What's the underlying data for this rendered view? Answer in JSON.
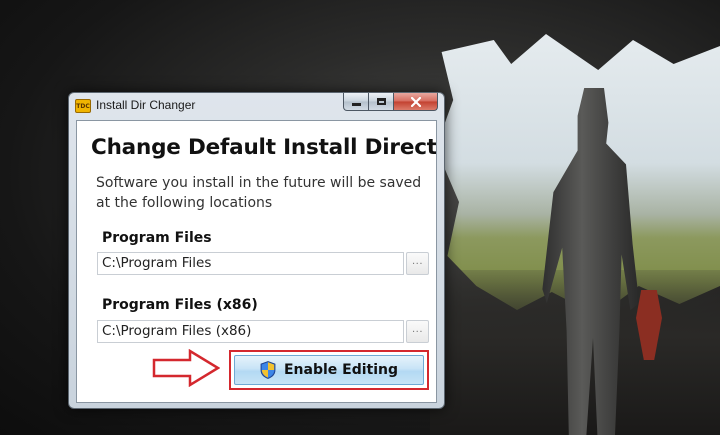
{
  "window": {
    "title": "Install Dir Changer",
    "app_icon_text": "TDC"
  },
  "content": {
    "heading": "Change Default Install Directo",
    "description": "Software you install in the future will be saved at the following locations",
    "program_files": {
      "label": "Program Files",
      "value": "C:\\Program Files",
      "browse_label": "..."
    },
    "program_files_x86": {
      "label": "Program Files (x86)",
      "value": "C:\\Program Files (x86)",
      "browse_label": "..."
    },
    "enable_button": {
      "label": "Enable Editing",
      "icon": "uac-shield-icon"
    }
  },
  "annotations": {
    "highlight_color": "#d4282e",
    "arrow_icon": "right-arrow-outline-icon"
  }
}
